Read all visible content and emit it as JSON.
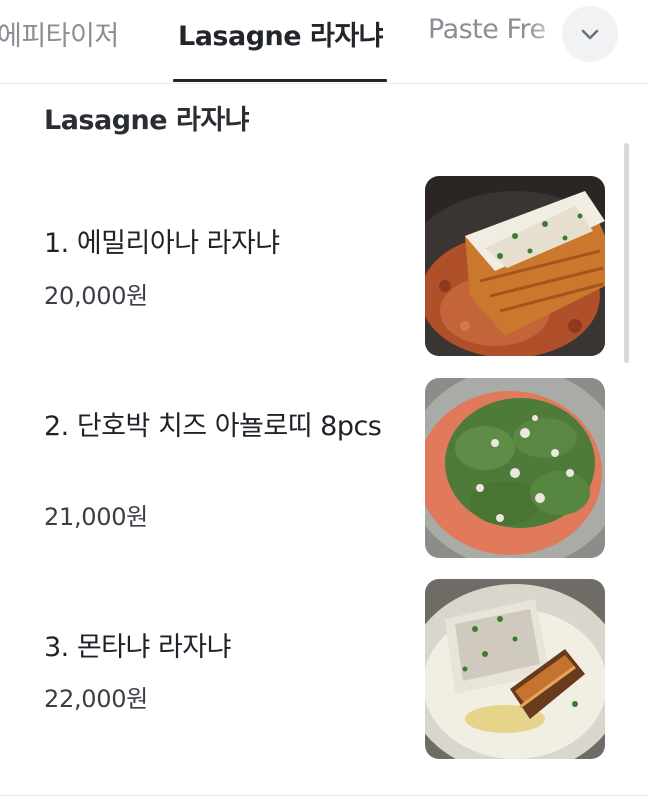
{
  "tabs": [
    {
      "label": "에피타이저",
      "active": false
    },
    {
      "label": "Lasagne 라자냐",
      "active": true
    },
    {
      "label": "Paste Fre",
      "active": false
    }
  ],
  "more_button_icon": "chevron-down-icon",
  "section": {
    "title": "Lasagne 라자냐",
    "items": [
      {
        "name": "1. 에밀리아나 라자냐",
        "price": "20,000원",
        "image": "emiliana-lasagna-photo"
      },
      {
        "name": "2. 단호박 치즈 아뇰로띠 8pcs",
        "price": "21,000원",
        "image": "pumpkin-agnolotti-photo"
      },
      {
        "name": "3. 몬타냐 라자냐",
        "price": "22,000원",
        "image": "montagna-lasagna-photo"
      }
    ]
  }
}
